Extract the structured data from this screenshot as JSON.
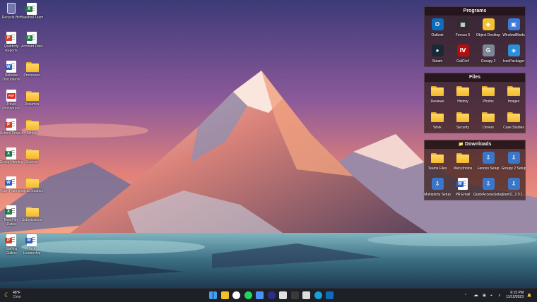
{
  "desktop": {
    "icons": [
      {
        "label": "Recycle Bin",
        "icon": "recycle-bin-icon"
      },
      {
        "label": "Baseball Team",
        "icon": "excel-file-icon"
      },
      {
        "label": "Quarterly Reports",
        "icon": "powerpoint-file-icon"
      },
      {
        "label": "Account Data",
        "icon": "excel-file-icon"
      },
      {
        "label": "Release Documents",
        "icon": "word-file-icon"
      },
      {
        "label": "Processes",
        "icon": "folder-icon"
      },
      {
        "label": "Travel Procedures",
        "icon": "pdf-file-icon"
      },
      {
        "label": "Resumes",
        "icon": "folder-icon"
      },
      {
        "label": "School Project",
        "icon": "powerpoint-file-icon"
      },
      {
        "label": "School",
        "icon": "folder-icon"
      },
      {
        "label": "Group Meeting",
        "icon": "excel-file-icon"
      },
      {
        "label": "Science",
        "icon": "folder-icon"
      },
      {
        "label": "Team Planning",
        "icon": "word-file-icon"
      },
      {
        "label": "Social Studies",
        "icon": "folder-icon"
      },
      {
        "label": "New Hire Dates",
        "icon": "excel-file-icon"
      },
      {
        "label": "Submissions",
        "icon": "folder-icon"
      },
      {
        "label": "Staffing Outline",
        "icon": "powerpoint-file-icon"
      },
      {
        "label": "Task Leadership",
        "icon": "word-file-icon"
      }
    ]
  },
  "fences": {
    "programs": {
      "title": "Programs",
      "items": [
        {
          "label": "Outlook",
          "icon": "outlook-icon"
        },
        {
          "label": "Fences 5",
          "icon": "fences-icon"
        },
        {
          "label": "Object Desktop",
          "icon": "object-desktop-icon"
        },
        {
          "label": "WindowBlinds",
          "icon": "windowblinds-icon"
        },
        {
          "label": "Steam",
          "icon": "steam-icon"
        },
        {
          "label": "GalCiv4",
          "icon": "galciv-icon"
        },
        {
          "label": "Groupy 2",
          "icon": "groupy-icon"
        },
        {
          "label": "IconPackager",
          "icon": "iconpackager-icon"
        }
      ]
    },
    "files": {
      "title": "Files",
      "items": [
        {
          "label": "Reviews"
        },
        {
          "label": "History"
        },
        {
          "label": "Photos"
        },
        {
          "label": "Images"
        },
        {
          "label": "Work"
        },
        {
          "label": "Security"
        },
        {
          "label": "Drivers"
        },
        {
          "label": "Case Studies"
        }
      ]
    },
    "downloads": {
      "title": "Downloads",
      "items": [
        {
          "label": "Teams Files",
          "icon": "folder-icon"
        },
        {
          "label": "Web photos",
          "icon": "folder-icon"
        },
        {
          "label": "Fences Setup",
          "icon": "installer-icon"
        },
        {
          "label": "Groupy 2 Setup",
          "icon": "installer-icon"
        },
        {
          "label": "Multiplicity Setup",
          "icon": "installer-icon"
        },
        {
          "label": "PR Email",
          "icon": "word-file-icon"
        },
        {
          "label": "QuickAccessSetup",
          "icon": "installer-icon"
        },
        {
          "label": "Start11_2.0.1...",
          "icon": "installer-icon"
        }
      ]
    }
  },
  "taskbar": {
    "weather": {
      "temp": "48°F",
      "condition": "Clear"
    },
    "apps": [
      "start-icon",
      "file-explorer-icon",
      "browser-icon",
      "spotify-icon",
      "store-icon",
      "app-icon",
      "notes-icon",
      "fences-icon",
      "settings-icon",
      "edge-icon",
      "outlook-icon"
    ],
    "clock": {
      "time": "6:15 PM",
      "date": "11/12/2023"
    }
  },
  "colors": {
    "taskbar": "#1d2027",
    "fence_bg": "#341e1c",
    "folder": "#f4b92c",
    "word": "#2b5cb8",
    "excel": "#1f7a43",
    "powerpoint": "#c8432b",
    "pdf": "#d9302a"
  }
}
